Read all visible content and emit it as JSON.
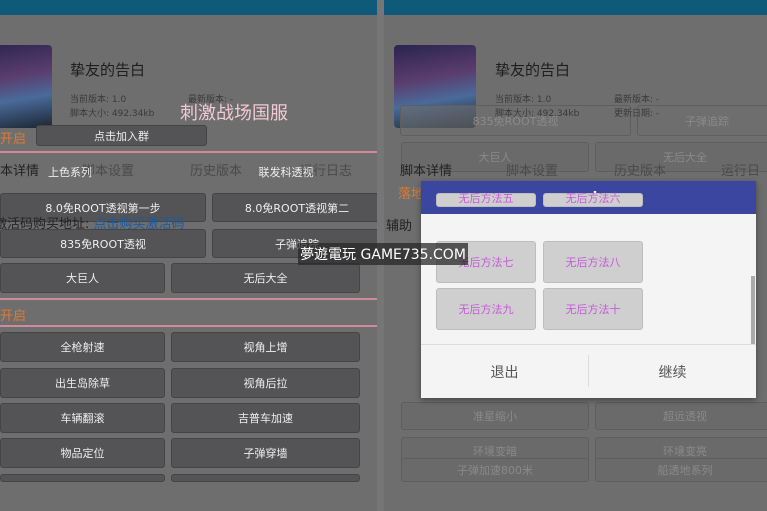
{
  "left": {
    "script_title": "挚友的告白",
    "current_version": "当前版本: 1.0",
    "latest_version": "最新版本: -",
    "script_size": "脚本大小: 492.34kb",
    "overlay_title": "刺激战场国服",
    "section1": "开启",
    "join_group": "点击加入群",
    "tabs": [
      "本详情",
      "脚本设置",
      "历史版本",
      "运行日志"
    ],
    "purchase_label": "激活码购买地址:",
    "purchase_link": "点击购买激活码",
    "buttons_top": [
      "上色系列",
      "联发科透视",
      "8.0免ROOT透视第一步",
      "8.0免ROOT透视第二",
      "835免ROOT透视",
      "子弹追踪",
      "大巨人",
      "无后大全"
    ],
    "section2": "开启",
    "buttons_bottom": [
      "全枪射速",
      "视角上增",
      "出生岛除草",
      "视角后拉",
      "车辆翻滚",
      "吉普车加速",
      "物品定位",
      "子弹穿墙"
    ]
  },
  "right": {
    "script_title": "挚友的告白",
    "current_version": "当前版本: 1.0",
    "latest_version": "最新版本: -",
    "script_size": "脚本大小: 492.34kb",
    "update_date": "更新日期: -",
    "bg_buttons": [
      "835免ROOT透视",
      "子弹追踪",
      "大巨人",
      "无后大全"
    ],
    "tabs": [
      "脚本详情",
      "脚本设置",
      "历史版本",
      "运行日志"
    ],
    "section": "落地",
    "aux": "辅助",
    "bg_bottom": [
      "准星缩小",
      "超远透视",
      "环境变暗",
      "环境变亮",
      "子弹加速800米",
      "船透地系列"
    ],
    "dialog": {
      "title": "main",
      "buttons": [
        "无后方法五",
        "无后方法六",
        "无后方法七",
        "无后方法八",
        "无后方法九",
        "无后方法十"
      ],
      "exit": "退出",
      "continue": "继续"
    }
  },
  "watermark": "夢遊電玩 GAME735.COM"
}
